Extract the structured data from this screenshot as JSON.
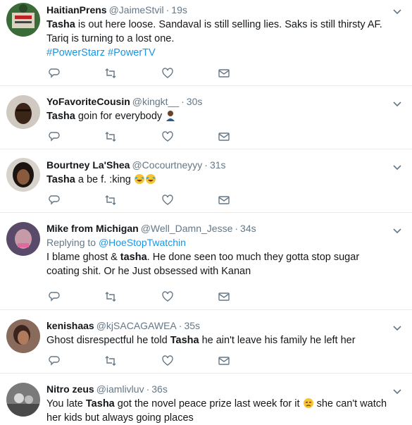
{
  "tweets": [
    {
      "name": "HaitianPrens",
      "handle": "@JaimeStvil",
      "time": "19s",
      "bold": "Tasha",
      "text": " is out here loose. Sandaval is still selling lies. Saks is still thirsty AF. Tariq is turning to a lost one.",
      "hashtags": [
        "#PowerStarz",
        "#PowerTV"
      ]
    },
    {
      "name": "YoFavoriteCousin",
      "handle": "@kingkt__",
      "time": "30s",
      "bold": "Tasha",
      "text": " goin for everybody "
    },
    {
      "name": "Bourtney La'Shea",
      "handle": "@Cocourtneyyy",
      "time": "31s",
      "bold": "Tasha",
      "text": " a    be f.  :king "
    },
    {
      "name": "Mike from Michigan",
      "handle": "@Well_Damn_Jesse",
      "time": "34s",
      "reply_prefix": "Replying to ",
      "reply_to": "@HoeStopTwatchin",
      "pre": "I blame ghost & ",
      "bold": "tasha",
      "text": ". He done seen too much they gotta stop sugar coating shit. Or he Just obsessed with Kanan"
    },
    {
      "name": "kenishaas",
      "handle": "@kjSACAGAWEA",
      "time": "35s",
      "pre": "Ghost disrespectful he told ",
      "bold": "Tasha",
      "text": " he ain't leave his family he left her"
    },
    {
      "name": "Nitro zeus",
      "handle": "@iamlivluv",
      "time": "36s",
      "pre": "You late ",
      "bold": "Tasha",
      "text": " got the novel peace prize last week for it ",
      "text2": " she can't watch her kids but always going places"
    }
  ],
  "separator": "·",
  "icons": [
    "reply-icon",
    "retweet-icon",
    "like-icon",
    "direct-message-icon",
    "chevron-down-icon"
  ],
  "colors": {
    "link": "#1b95e0",
    "muted": "#657786",
    "text": "#14171a",
    "border": "#e6ecf0"
  }
}
